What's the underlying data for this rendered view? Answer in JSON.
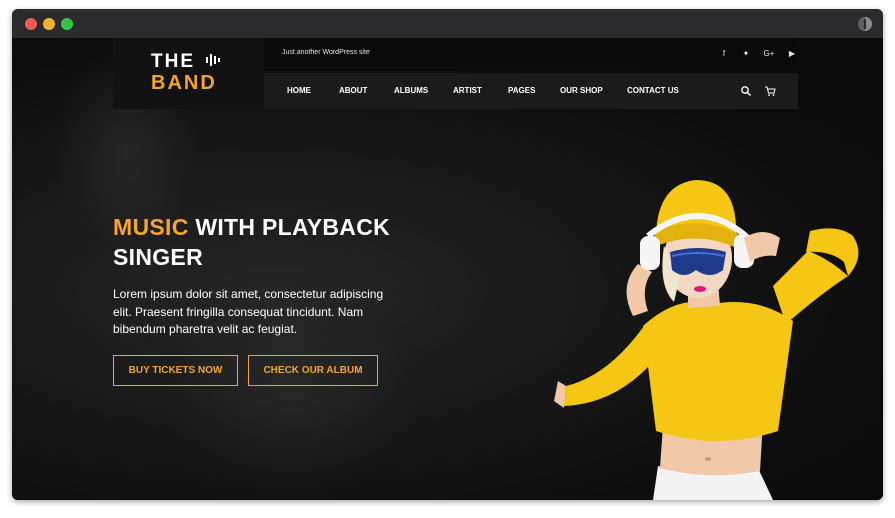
{
  "site": {
    "logo_line1": "THE",
    "logo_line2": "BAND",
    "tagline": "Just another WordPress site"
  },
  "social": [
    {
      "icon": "facebook-icon",
      "glyph": "f"
    },
    {
      "icon": "twitter-icon",
      "glyph": "✦"
    },
    {
      "icon": "google-plus-icon",
      "glyph": "G+"
    },
    {
      "icon": "youtube-icon",
      "glyph": "▶"
    }
  ],
  "nav": [
    "HOME",
    "ABOUT",
    "ALBUMS",
    "ARTIST",
    "PAGES",
    "OUR SHOP",
    "CONTACT US"
  ],
  "hero": {
    "title_accent": "MUSIC",
    "title_rest": " WITH PLAYBACK",
    "title_line2": "SINGER",
    "text": "Lorem ipsum dolor sit amet, consectetur adipiscing elit. Praesent fringilla consequat tincidunt. Nam bibendum pharetra velit ac feugiat.",
    "button1": "BUY TICKETS NOW",
    "button2": "CHECK OUR ALBUM"
  },
  "colors": {
    "accent": "#f3a431",
    "background": "#0c0c0c",
    "navbar": "#1b1b1b",
    "singer_top": "#f5c614"
  }
}
